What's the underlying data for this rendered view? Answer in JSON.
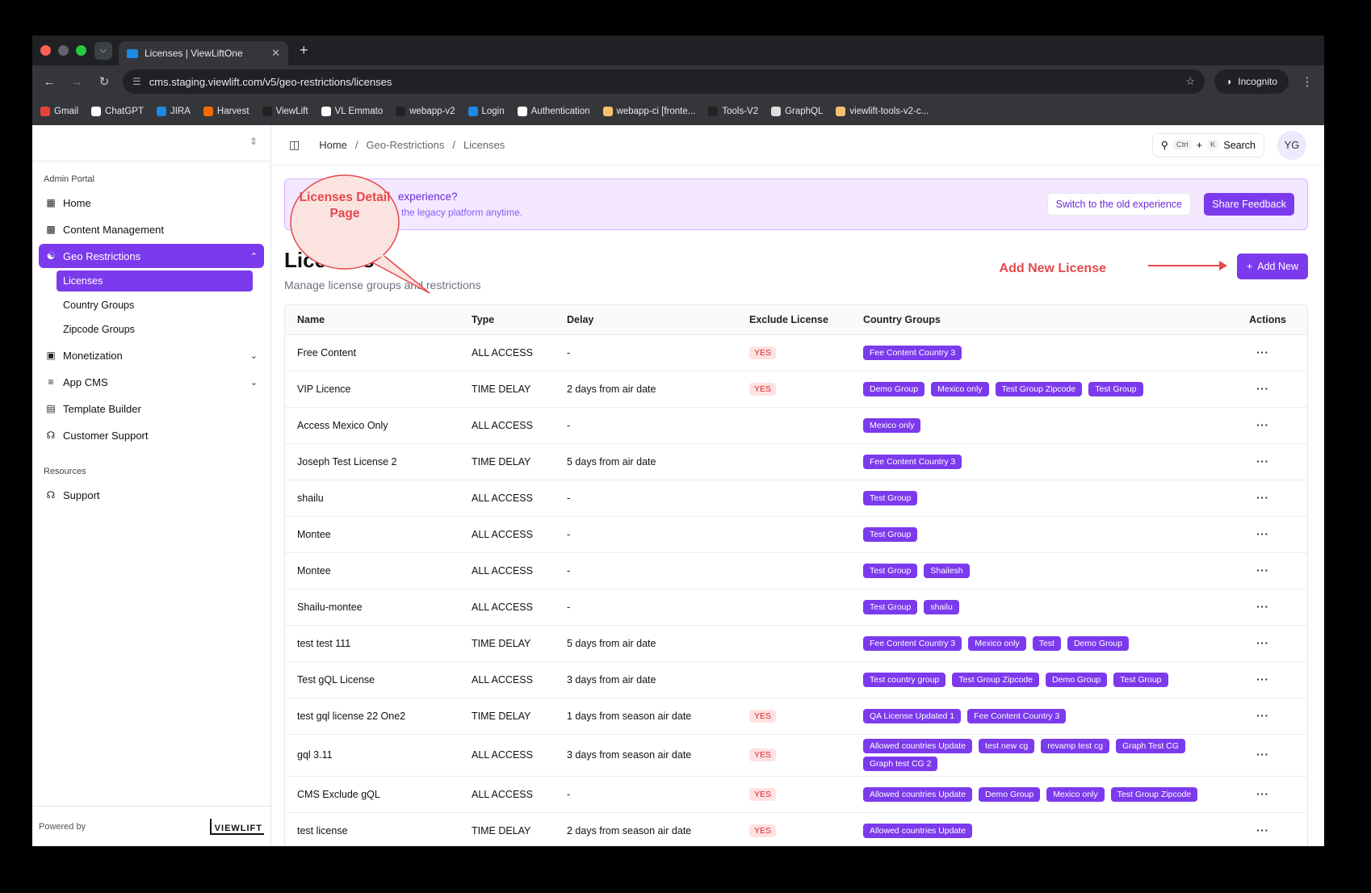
{
  "browser": {
    "tab_title": "Licenses | ViewLiftOne",
    "url": "cms.staging.viewlift.com/v5/geo-restrictions/licenses",
    "incognito_label": "Incognito",
    "bookmarks": [
      {
        "label": "Gmail",
        "color": "#ea4335"
      },
      {
        "label": "ChatGPT",
        "color": "#ffffff"
      },
      {
        "label": "JIRA",
        "color": "#1e88e5"
      },
      {
        "label": "Harvest",
        "color": "#f36c00"
      },
      {
        "label": "ViewLift",
        "color": "#222222"
      },
      {
        "label": "VL Emmato",
        "color": "#ffffff"
      },
      {
        "label": "webapp-v2",
        "color": "#222222"
      },
      {
        "label": "Login",
        "color": "#1e88e5"
      },
      {
        "label": "Authentication",
        "color": "#ffffff"
      },
      {
        "label": "webapp-ci [fronte...",
        "color": "#f5c16c"
      },
      {
        "label": "Tools-V2",
        "color": "#222222"
      },
      {
        "label": "GraphQL",
        "color": "#dddddd"
      },
      {
        "label": "viewlift-tools-v2-c...",
        "color": "#f5c16c"
      }
    ]
  },
  "sidebar": {
    "section_admin": "Admin Portal",
    "items": [
      {
        "label": "Home",
        "icon": "grid-icon"
      },
      {
        "label": "Content Management",
        "icon": "table-icon"
      },
      {
        "label": "Geo Restrictions",
        "icon": "globe-icon"
      }
    ],
    "geo_sub": [
      "Licenses",
      "Country Groups",
      "Zipcode Groups"
    ],
    "items_after": [
      {
        "label": "Monetization",
        "icon": "wallet-icon"
      },
      {
        "label": "App CMS",
        "icon": "sliders-icon"
      },
      {
        "label": "Template Builder",
        "icon": "layout-icon"
      },
      {
        "label": "Customer Support",
        "icon": "headset-icon"
      }
    ],
    "section_resources": "Resources",
    "support": "Support",
    "powered_by": "Powered by",
    "logo_text": "VIEWLIFT"
  },
  "topbar": {
    "breadcrumb": [
      "Home",
      "Geo-Restrictions",
      "Licenses"
    ],
    "kbd_ctrl": "Ctrl",
    "kbd_plus": "+",
    "kbd_k": "K",
    "search_label": "Search",
    "avatar": "YG"
  },
  "banner": {
    "question": "experience?",
    "sub": "o the legacy platform anytime.",
    "switch_btn": "Switch to the old experience",
    "feedback_btn": "Share Feedback"
  },
  "page": {
    "title": "Licenses",
    "subtitle": "Manage license groups and restrictions",
    "annotation_callout": "Licenses Detail Page",
    "annotation_add": "Add New License",
    "add_button": "Add New"
  },
  "table": {
    "headers": [
      "Name",
      "Type",
      "Delay",
      "Exclude License",
      "Country Groups",
      "Actions"
    ],
    "rows": [
      {
        "name": "Free Content",
        "type": "ALL ACCESS",
        "delay": "-",
        "exclude": "YES",
        "groups": [
          "Fee Content Country 3"
        ]
      },
      {
        "name": "VIP Licence",
        "type": "TIME DELAY",
        "delay": "2 days from air date",
        "exclude": "YES",
        "groups": [
          "Demo Group",
          "Mexico only",
          "Test Group Zipcode",
          "Test Group"
        ]
      },
      {
        "name": "Access Mexico Only",
        "type": "ALL ACCESS",
        "delay": "-",
        "exclude": "",
        "groups": [
          "Mexico only"
        ]
      },
      {
        "name": "Joseph Test License 2",
        "type": "TIME DELAY",
        "delay": "5 days from air date",
        "exclude": "",
        "groups": [
          "Fee Content Country 3"
        ]
      },
      {
        "name": "shailu",
        "type": "ALL ACCESS",
        "delay": "-",
        "exclude": "",
        "groups": [
          "Test Group"
        ]
      },
      {
        "name": "Montee",
        "type": "ALL ACCESS",
        "delay": "-",
        "exclude": "",
        "groups": [
          "Test Group"
        ]
      },
      {
        "name": "Montee",
        "type": "ALL ACCESS",
        "delay": "-",
        "exclude": "",
        "groups": [
          "Test Group",
          "Shailesh"
        ]
      },
      {
        "name": "Shailu-montee",
        "type": "ALL ACCESS",
        "delay": "-",
        "exclude": "",
        "groups": [
          "Test Group",
          "shailu"
        ]
      },
      {
        "name": "test test 111",
        "type": "TIME DELAY",
        "delay": "5 days from air date",
        "exclude": "",
        "groups": [
          "Fee Content Country 3",
          "Mexico only",
          "Test",
          "Demo Group"
        ]
      },
      {
        "name": "Test gQL License",
        "type": "ALL ACCESS",
        "delay": "3 days from air date",
        "exclude": "",
        "groups": [
          "Test country group",
          "Test Group Zipcode",
          "Demo Group",
          "Test Group"
        ]
      },
      {
        "name": "test gql license 22 One2",
        "type": "TIME DELAY",
        "delay": "1 days from season air date",
        "exclude": "YES",
        "groups": [
          "QA License Updated 1",
          "Fee Content Country 3"
        ]
      },
      {
        "name": "gql 3.11",
        "type": "ALL ACCESS",
        "delay": "3 days from season air date",
        "exclude": "YES",
        "groups": [
          "Allowed countries Update",
          "test new cg",
          "revamp test cg",
          "Graph Test CG",
          "Graph test CG 2"
        ]
      },
      {
        "name": "CMS Exclude gQL",
        "type": "ALL ACCESS",
        "delay": "-",
        "exclude": "YES",
        "groups": [
          "Allowed countries Update",
          "Demo Group",
          "Mexico only",
          "Test Group Zipcode"
        ]
      },
      {
        "name": "test license",
        "type": "TIME DELAY",
        "delay": "2 days from season air date",
        "exclude": "YES",
        "groups": [
          "Allowed countries Update"
        ]
      }
    ]
  },
  "colors": {
    "accent": "#7c3aed",
    "annotation": "#e5484d"
  }
}
